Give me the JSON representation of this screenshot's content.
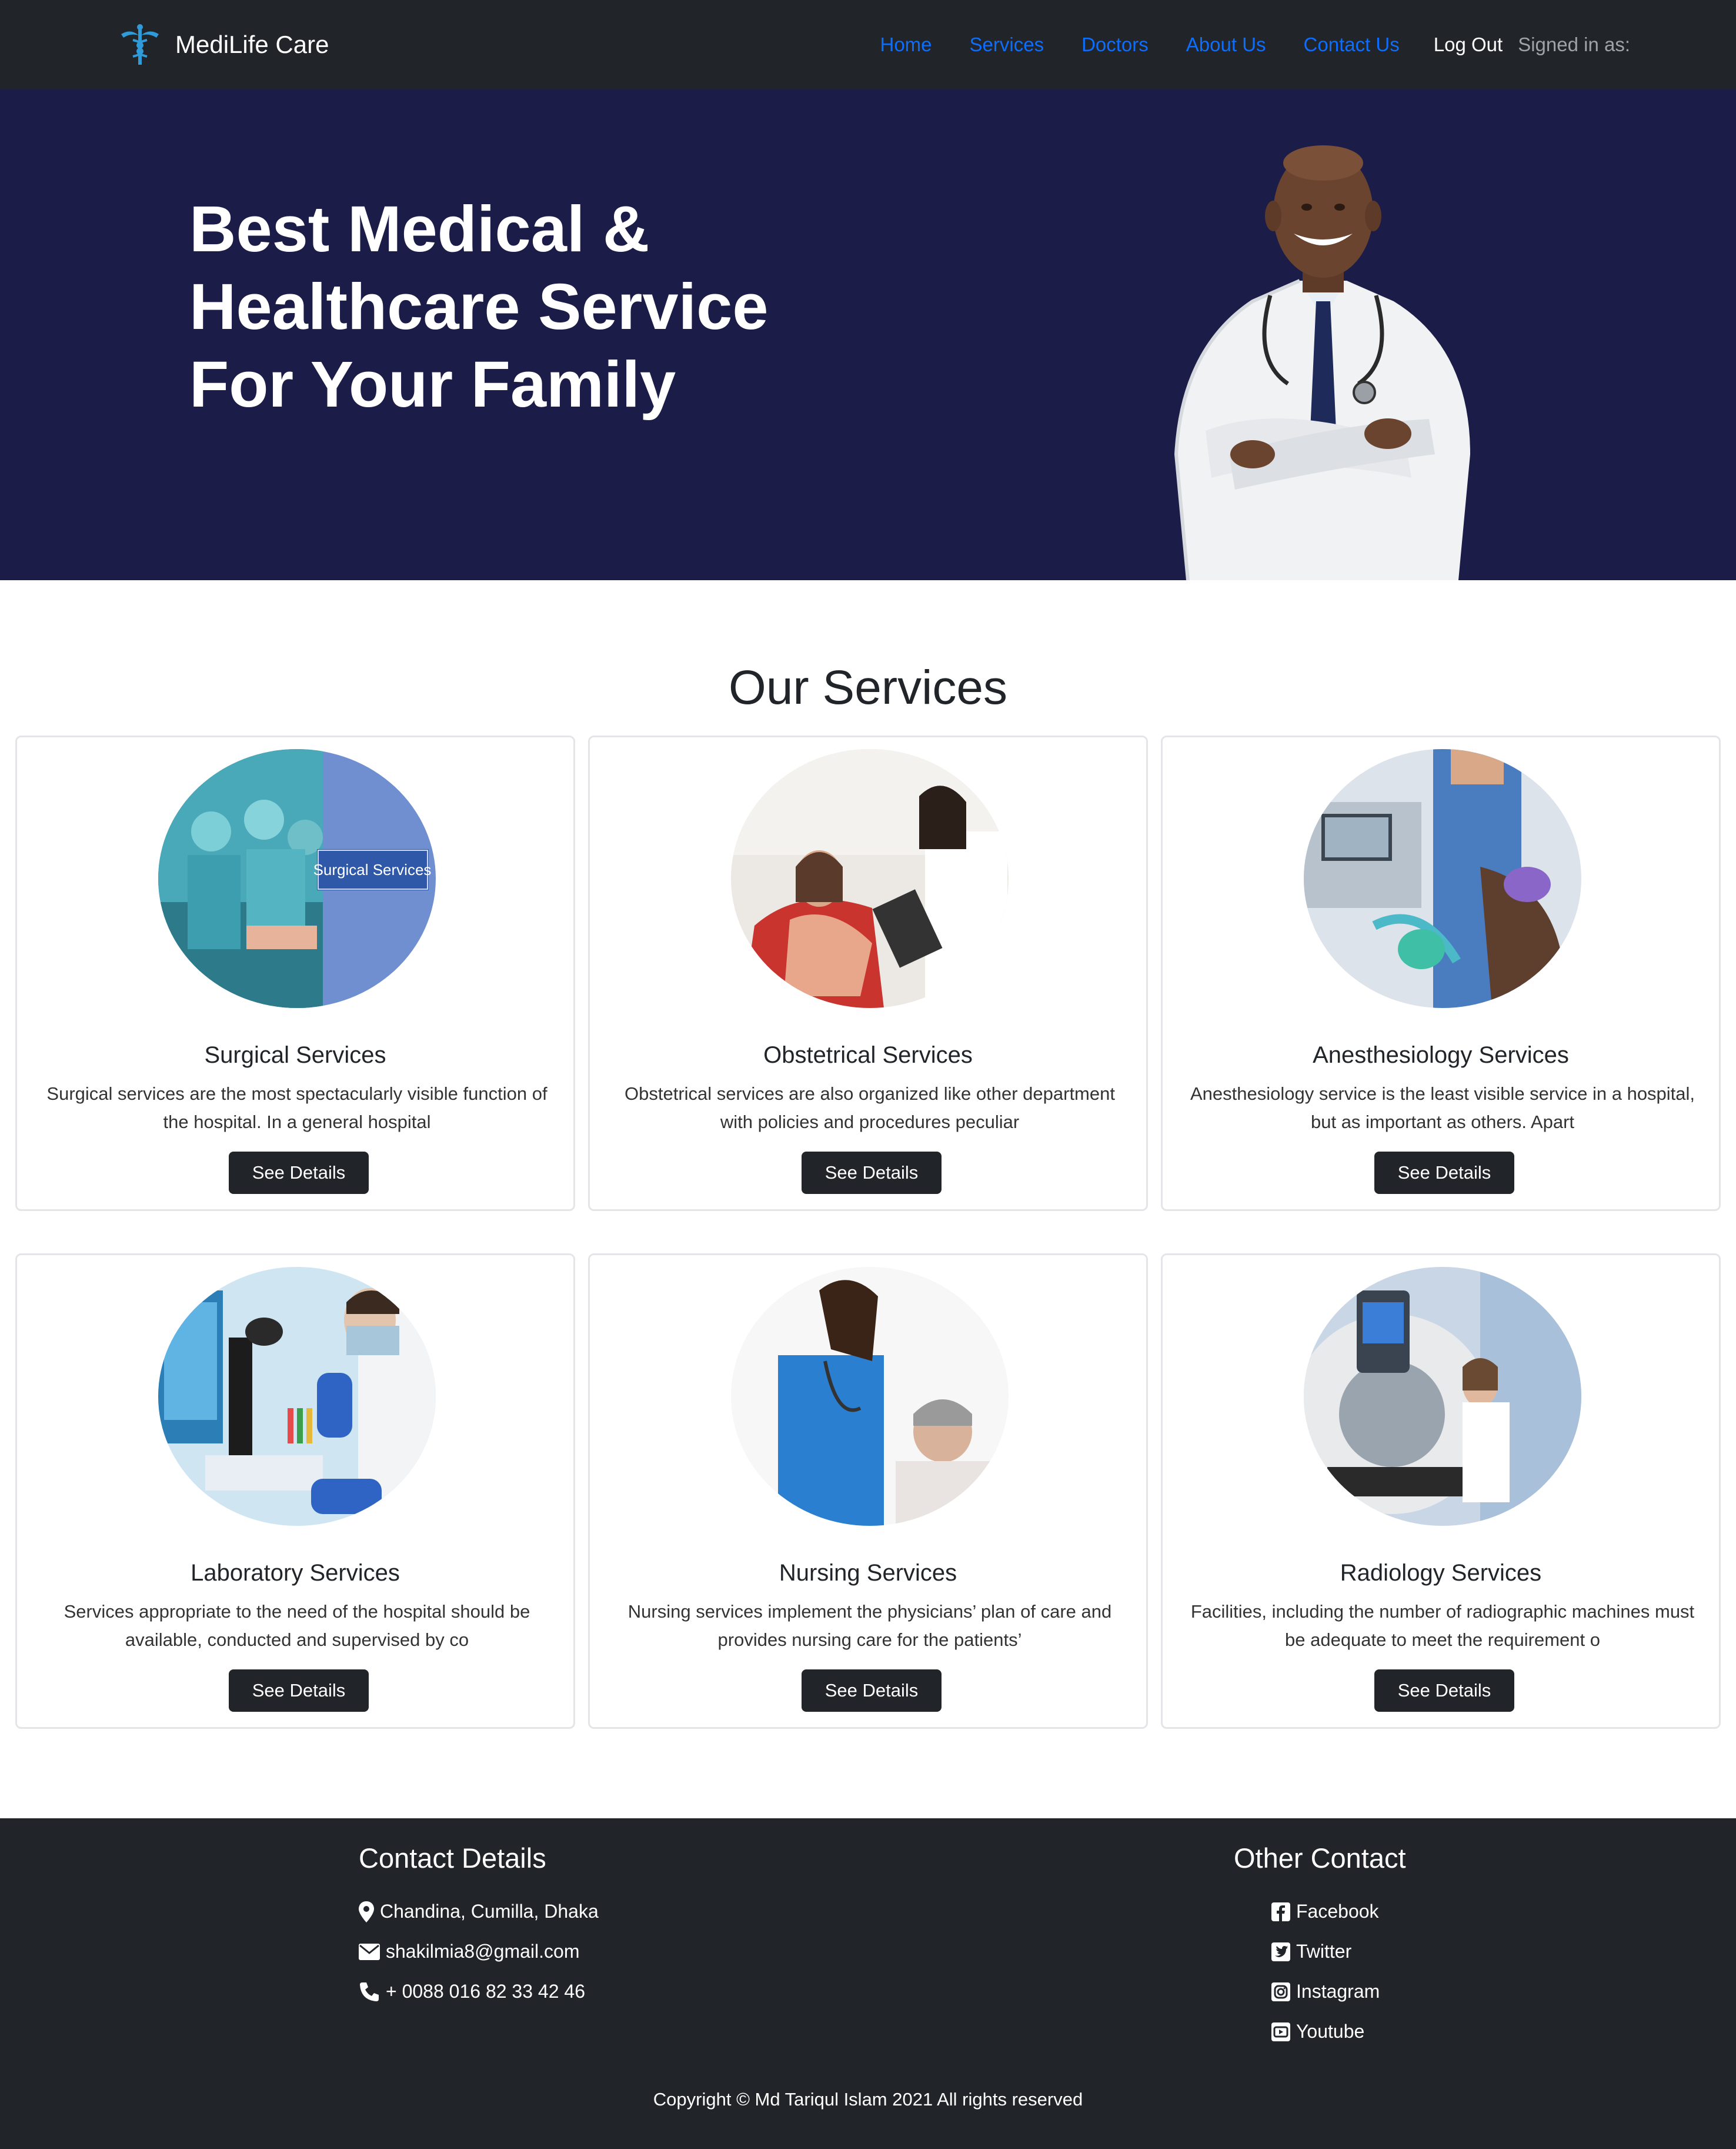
{
  "navbar": {
    "brand": "MediLife Care",
    "links": [
      "Home",
      "Services",
      "Doctors",
      "About Us",
      "Contact Us"
    ],
    "logout": "Log Out",
    "signed_in": "Signed in as:"
  },
  "hero": {
    "title_lines": [
      "Best Medical &",
      "Healthcare Service",
      "For Your Family"
    ]
  },
  "services": {
    "heading": "Our Services",
    "button_label": "See Details",
    "items": [
      {
        "title": "Surgical Services",
        "text": "Surgical services are the most spectacularly visible function of the hospital. In a general hospital",
        "image_label": "Surgical Services"
      },
      {
        "title": "Obstetrical Services",
        "text": "Obstetrical services are also organized like other department with policies and procedures peculiar"
      },
      {
        "title": "Anesthesiology Services",
        "text": "Anesthesiology service is the least visible service in a hospital, but as important as others. Apart"
      },
      {
        "title": "Laboratory Services",
        "text": "Services appropriate to the need of the hospital should be available, conducted and supervised by co"
      },
      {
        "title": "Nursing Services",
        "text": "Nursing services implement the physicians’ plan of care and provides nursing care for the patients’"
      },
      {
        "title": "Radiology Services",
        "text": "Facilities, including the number of radiographic machines must be adequate to meet the requirement o"
      }
    ]
  },
  "footer": {
    "contact_heading": "Contact Details",
    "address": "Chandina, Cumilla, Dhaka",
    "email": "shakilmia8@gmail.com",
    "phone": "+ 0088 016 82 33 42 46",
    "other_heading": "Other Contact",
    "social": [
      "Facebook",
      "Twitter",
      "Instagram",
      "Youtube"
    ],
    "copyright": "Copyright © Md Tariqul Islam 2021 All rights reserved"
  },
  "colors": {
    "navbar_bg": "#212529",
    "hero_bg": "#1c1c48",
    "link": "#0d6efd",
    "button_bg": "#212529"
  }
}
